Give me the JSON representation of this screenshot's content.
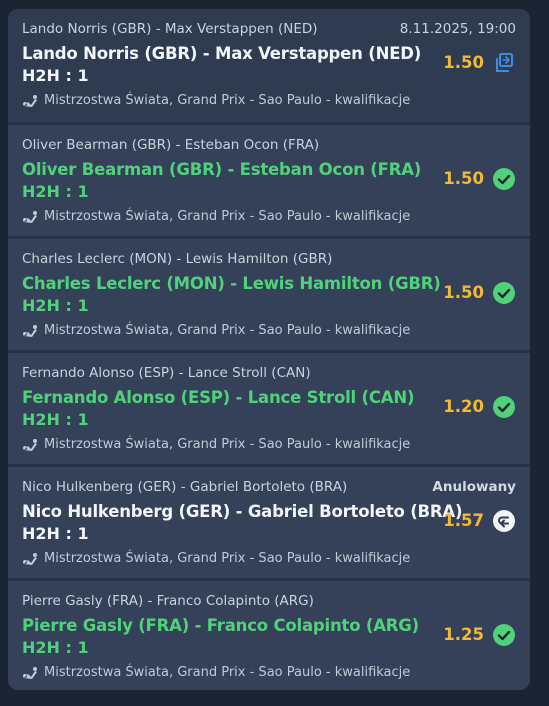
{
  "colors": {
    "won": "#4fd27a",
    "odds": "#f3b836",
    "pending_icon": "#3b8de6",
    "panel": "#2e3b51"
  },
  "events": [
    {
      "header": "Lando Norris (GBR) - Max Verstappen (NED)",
      "header_right": "8.11.2025, 19:00",
      "selection": "Lando Norris (GBR) - Max Verstappen (NED)",
      "market": "H2H : 1",
      "league": "Mistrzostwa Świata, Grand Prix - Sao Paulo - kwalifikacje",
      "odds": "1.50",
      "state": "pending",
      "icon": "pending-icon"
    },
    {
      "header": "Oliver Bearman (GBR) - Esteban Ocon (FRA)",
      "header_right": "",
      "selection": "Oliver Bearman (GBR) - Esteban Ocon (FRA)",
      "market": "H2H : 1",
      "league": "Mistrzostwa Świata, Grand Prix - Sao Paulo - kwalifikacje",
      "odds": "1.50",
      "state": "won",
      "icon": "check-icon"
    },
    {
      "header": "Charles Leclerc (MON) - Lewis Hamilton (GBR)",
      "header_right": "",
      "selection": "Charles Leclerc (MON) - Lewis Hamilton (GBR)",
      "market": "H2H : 1",
      "league": "Mistrzostwa Świata, Grand Prix - Sao Paulo - kwalifikacje",
      "odds": "1.50",
      "state": "won",
      "icon": "check-icon"
    },
    {
      "header": "Fernando Alonso (ESP) - Lance Stroll (CAN)",
      "header_right": "",
      "selection": "Fernando Alonso (ESP) - Lance Stroll (CAN)",
      "market": "H2H : 1",
      "league": "Mistrzostwa Świata, Grand Prix - Sao Paulo - kwalifikacje",
      "odds": "1.20",
      "state": "won",
      "icon": "check-icon"
    },
    {
      "header": "Nico Hulkenberg (GER) - Gabriel Bortoleto (BRA)",
      "header_right": "Anulowany",
      "selection": "Nico Hulkenberg (GER) - Gabriel Bortoleto (BRA)",
      "market": "H2H : 1",
      "league": "Mistrzostwa Świata, Grand Prix - Sao Paulo - kwalifikacje",
      "odds": "1.57",
      "state": "void",
      "icon": "return-icon"
    },
    {
      "header": "Pierre Gasly (FRA) - Franco Colapinto (ARG)",
      "header_right": "",
      "selection": "Pierre Gasly (FRA) - Franco Colapinto (ARG)",
      "market": "H2H : 1",
      "league": "Mistrzostwa Świata, Grand Prix - Sao Paulo - kwalifikacje",
      "odds": "1.25",
      "state": "won",
      "icon": "check-icon"
    }
  ]
}
